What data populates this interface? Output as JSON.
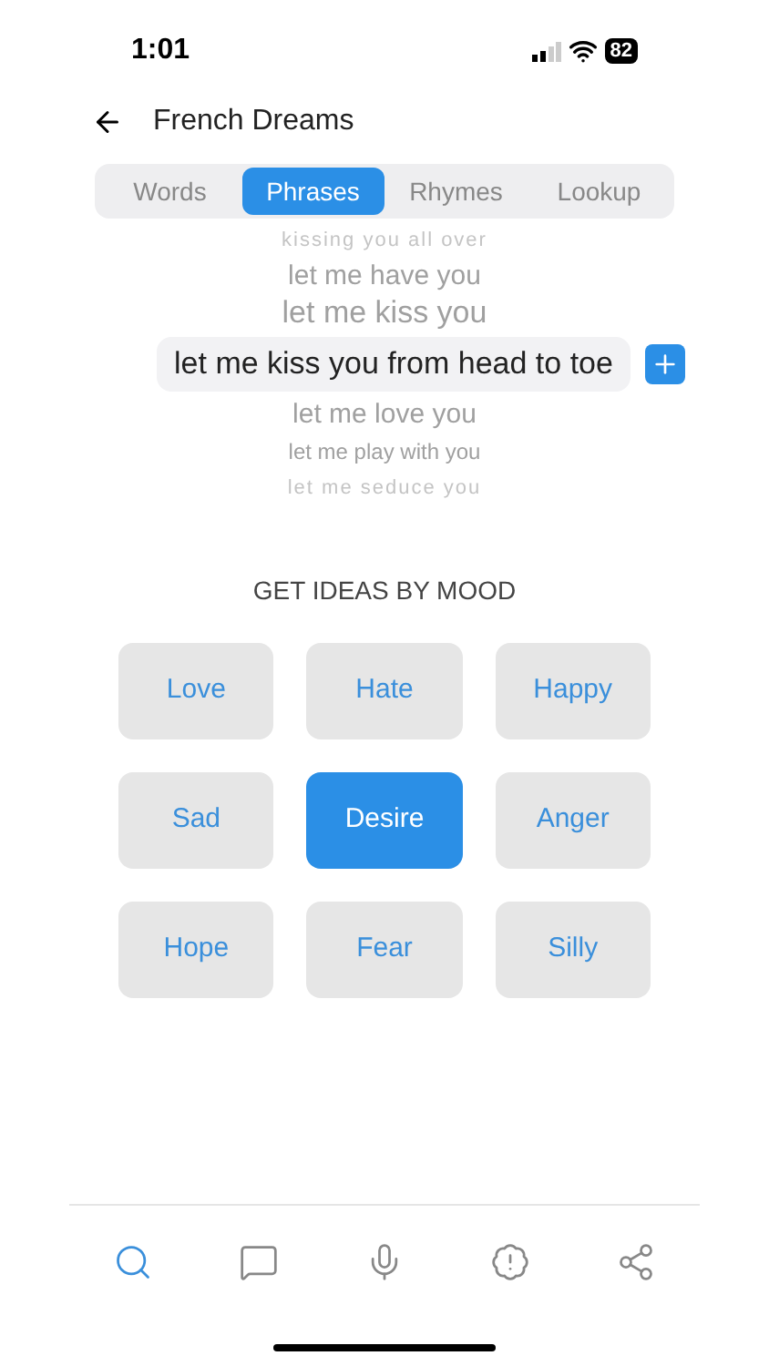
{
  "status_bar": {
    "time": "1:01",
    "battery": "82"
  },
  "header": {
    "title": "French Dreams"
  },
  "tabs": [
    {
      "label": "Words",
      "selected": false
    },
    {
      "label": "Phrases",
      "selected": true
    },
    {
      "label": "Rhymes",
      "selected": false
    },
    {
      "label": "Lookup",
      "selected": false
    }
  ],
  "phrases": [
    {
      "text": "kissing you all over",
      "selected": false
    },
    {
      "text": "let me have you",
      "selected": false
    },
    {
      "text": "let me kiss you",
      "selected": false
    },
    {
      "text": "let me kiss you from head to toe",
      "selected": true
    },
    {
      "text": "let me love you",
      "selected": false
    },
    {
      "text": "let me play with you",
      "selected": false
    },
    {
      "text": "let me seduce you",
      "selected": false
    }
  ],
  "mood_heading": "GET IDEAS BY MOOD",
  "moods": [
    {
      "label": "Love",
      "selected": false
    },
    {
      "label": "Hate",
      "selected": false
    },
    {
      "label": "Happy",
      "selected": false
    },
    {
      "label": "Sad",
      "selected": false
    },
    {
      "label": "Desire",
      "selected": true
    },
    {
      "label": "Anger",
      "selected": false
    },
    {
      "label": "Hope",
      "selected": false
    },
    {
      "label": "Fear",
      "selected": false
    },
    {
      "label": "Silly",
      "selected": false
    }
  ],
  "nav": [
    {
      "kind": "search",
      "selected": true
    },
    {
      "kind": "notes",
      "selected": false
    },
    {
      "kind": "mic",
      "selected": false
    },
    {
      "kind": "alert",
      "selected": false
    },
    {
      "kind": "share",
      "selected": false
    }
  ]
}
